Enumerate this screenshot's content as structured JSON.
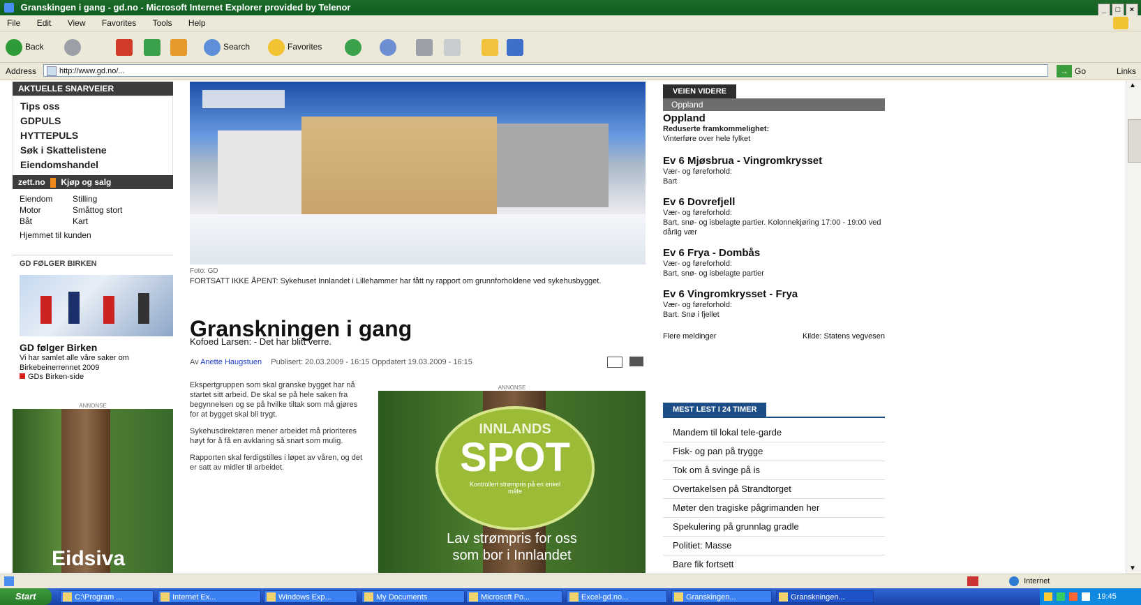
{
  "window": {
    "title": "Granskingen i gang - gd.no - Microsoft Internet Explorer provided by Telenor",
    "menu": [
      "File",
      "Edit",
      "View",
      "Favorites",
      "Tools",
      "Help"
    ],
    "toolbar": {
      "back": "Back",
      "search": "Search",
      "favorites": "Favorites"
    },
    "address": {
      "label": "Address",
      "url": "http://www.gd.no/...",
      "go": "Go",
      "links": "Links"
    }
  },
  "left": {
    "shortcuts_title": "AKTUELLE SNARVEIER",
    "shortcuts": [
      "Tips oss",
      "GDPULS",
      "HYTTEPULS",
      "Søk i Skattelistene",
      "Eiendomshandel"
    ],
    "zett_title": "zett.no",
    "zett_subtitle": "Kjøp og salg",
    "zett_items": [
      [
        "Eiendom",
        "Stilling"
      ],
      [
        "Motor",
        "Småttog stort"
      ],
      [
        "Båt",
        "Kart"
      ]
    ],
    "zett_extra": "Hjemmet til kunden",
    "promo_title": "GD FØLGER BIRKEN",
    "promo_heading": "GD følger Birken",
    "promo_text": "Vi har samlet alle våre saker om Birkebeinerrennet 2009",
    "promo_link": "GDs Birken-side",
    "ad_label": "ANNONSE",
    "ad_text": "Eidsiva"
  },
  "article": {
    "photo_credit": "Foto: GD",
    "caption": "FORTSATT IKKE ÅPENT: Sykehuset Innlandet i Lillehammer har fått ny rapport om grunnforholdene ved sykehusbygget.",
    "headline": "Granskningen i gang",
    "ingress": "Kofoed Larsen: - Det har blitt verre.",
    "byline_prefix": "Av",
    "author": "Anette Haugstuen",
    "published": "Publisert: 20.03.2009 - 16:15 Oppdatert 19.03.2009 - 16:15",
    "paragraphs": [
      "Ekspertgruppen som skal granske bygget har nå startet sitt arbeid. De skal se på hele saken fra begynnelsen og se på hvilke tiltak som må gjøres for at bygget skal bli trygt.",
      "Sykehusdirektøren mener arbeidet må prioriteres høyt for å få en avklaring så snart som mulig.",
      "Rapporten skal ferdigstilles i løpet av våren, og det er satt av midler til arbeidet."
    ],
    "ad_label": "ANNONSE",
    "ad_badge_top": "INNLANDS",
    "ad_badge_main": "SPOT",
    "ad_badge_sub": "Kontrollert strømpris på en enkel måte",
    "ad_line1": "Lav strømpris for oss",
    "ad_line2": "som bor i Innlandet"
  },
  "right": {
    "tab": "VEIEN VIDERE",
    "region_tab": "Oppland",
    "region": "Oppland",
    "region_sub": "Reduserte framkommelighet:",
    "region_sub2": "Vinterføre over hele fylket",
    "roads": [
      {
        "name": "Ev 6 Mjøsbrua - Vingromkrysset",
        "l1": "Vær- og føreforhold:",
        "l2": "Bart"
      },
      {
        "name": "Ev 6 Dovrefjell",
        "l1": "Vær- og føreforhold:",
        "l2": "Bart, snø- og isbelagte partier. Kolonnekjøring 17:00 - 19:00 ved dårlig vær"
      },
      {
        "name": "Ev 6 Fryа - Dombås",
        "l1": "Vær- og føreforhold:",
        "l2": "Bart, snø- og isbelagte partier"
      },
      {
        "name": "Ev 6 Vingromkrysset - Fryа",
        "l1": "Vær- og føreforhold:",
        "l2": "Bart. Snø i fjellet"
      }
    ],
    "footer_left": "Flere meldinger",
    "footer_right": "Kilde: Statens vegvesen",
    "list_tab": "MEST LEST I 24 TIMER",
    "list": [
      "Mandem til lokal tele-garde",
      "Fisk- og pan på trygge",
      "Tok om å svinge på is",
      "Overtakelsen på Strandtorget",
      "Møter den tragiske pågrimanden her",
      "Spekulering på grunnlag gradle",
      "Politiet: Masse",
      "Bare fik fortsett"
    ]
  },
  "status": {
    "text": "",
    "zone": "Internet"
  },
  "taskbar": {
    "start": "Start",
    "tasks": [
      "C:\\Program ...",
      "Internet Ex...",
      "Windows Exp...",
      "My Documents",
      "Microsoft Po...",
      "Excel-gd.no...",
      "Granskingen...",
      "Granskningen..."
    ],
    "clock": "19:45"
  }
}
